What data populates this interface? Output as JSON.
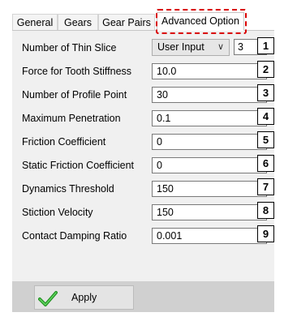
{
  "tabs": [
    {
      "label": "General"
    },
    {
      "label": "Gears"
    },
    {
      "label": "Gear Pairs"
    },
    {
      "label": "Advanced Option"
    }
  ],
  "accent_color": "#d90000",
  "form": {
    "rows": [
      {
        "label": "Number of Thin Slice",
        "select_value": "User Input",
        "value": "3",
        "marker": "1"
      },
      {
        "label": "Force for Tooth Stiffness",
        "value": "10.0",
        "marker": "2"
      },
      {
        "label": "Number of Profile Point",
        "value": "30",
        "marker": "3"
      },
      {
        "label": "Maximum Penetration",
        "value": "0.1",
        "marker": "4"
      },
      {
        "label": "Friction Coefficient",
        "value": "0",
        "marker": "5"
      },
      {
        "label": "Static Friction Coefficient",
        "value": "0",
        "marker": "6"
      },
      {
        "label": "Dynamics Threshold",
        "value": "150",
        "marker": "7"
      },
      {
        "label": "Stiction Velocity",
        "value": "150",
        "marker": "8"
      },
      {
        "label": "Contact Damping Ratio",
        "value": "0.001",
        "marker": "9"
      }
    ]
  },
  "footer": {
    "apply_label": "Apply",
    "apply_icon": "green-check-icon"
  }
}
